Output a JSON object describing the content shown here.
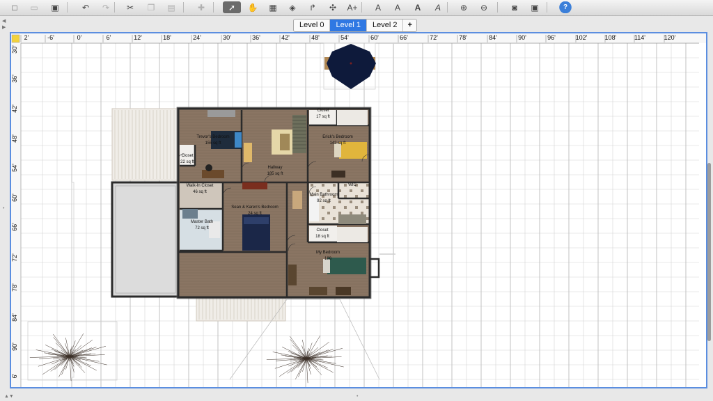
{
  "toolbar": {
    "buttons": [
      {
        "name": "new-home-icon",
        "glyph": "□"
      },
      {
        "name": "open-icon",
        "glyph": "▭"
      },
      {
        "name": "save-icon",
        "glyph": "▣"
      },
      {
        "name": "undo-icon",
        "glyph": "↶"
      },
      {
        "name": "redo-icon",
        "glyph": "↷"
      },
      {
        "name": "cut-icon",
        "glyph": "✂"
      },
      {
        "name": "copy-icon",
        "glyph": "❐"
      },
      {
        "name": "paste-icon",
        "glyph": "▤"
      },
      {
        "name": "add-furniture-icon",
        "glyph": "✚"
      },
      {
        "name": "select-mode-icon",
        "glyph": "➚"
      },
      {
        "name": "pan-mode-icon",
        "glyph": "✋"
      },
      {
        "name": "create-walls-icon",
        "glyph": "▦"
      },
      {
        "name": "create-rooms-icon",
        "glyph": "◈"
      },
      {
        "name": "create-polylines-icon",
        "glyph": "↱"
      },
      {
        "name": "create-dimensions-icon",
        "glyph": "✣"
      },
      {
        "name": "add-text-icon",
        "glyph": "A+"
      },
      {
        "name": "increase-text-size-icon",
        "glyph": "A"
      },
      {
        "name": "decrease-text-size-icon",
        "glyph": "A"
      },
      {
        "name": "bold-text-icon",
        "glyph": "A"
      },
      {
        "name": "italic-text-icon",
        "glyph": "A"
      },
      {
        "name": "zoom-in-icon",
        "glyph": "⊕"
      },
      {
        "name": "zoom-out-icon",
        "glyph": "⊖"
      },
      {
        "name": "create-photo-icon",
        "glyph": "◙"
      },
      {
        "name": "create-video-icon",
        "glyph": "▣"
      },
      {
        "name": "help-icon",
        "glyph": "?"
      }
    ]
  },
  "levels": {
    "tabs": [
      "Level 0",
      "Level 1",
      "Level 2"
    ],
    "active": "Level 1",
    "add_label": "+"
  },
  "ruler": {
    "top_labels": [
      "2'",
      "-6'",
      "0'",
      "6'",
      "12'",
      "18'",
      "24'",
      "30'",
      "36'",
      "42'",
      "48'",
      "54'",
      "60'",
      "66'",
      "72'",
      "78'",
      "84'",
      "90'",
      "96'",
      "102'",
      "108'",
      "114'",
      "120'"
    ],
    "left_labels": [
      "30'",
      "36'",
      "42'",
      "48'",
      "54'",
      "60'",
      "66'",
      "72'",
      "78'",
      "84'",
      "90'",
      "6'"
    ]
  },
  "rooms": [
    {
      "name": "Trevor's Bedroom",
      "area": "155 sq ft",
      "label": "Trevor's Bedroom"
    },
    {
      "name": "Hallway",
      "area": "185 sq ft"
    },
    {
      "name": "Closet",
      "area": "17 sq ft"
    },
    {
      "name": "Erick's Bedroom",
      "area": "142 sq ft"
    },
    {
      "name": "Closet",
      "area": "22 sq ft"
    },
    {
      "name": "Walk-In Closet",
      "area": "46 sq ft"
    },
    {
      "name": "Sean & Karen's Bedroom",
      "area": "24 sq ft"
    },
    {
      "name": "Main Bathroom",
      "area": "92 sq ft"
    },
    {
      "name": "Master Bath",
      "area": "72 sq ft"
    },
    {
      "name": "Closet",
      "area": "18 sq ft"
    },
    {
      "name": "My Bedroom",
      "area": "188"
    },
    {
      "name": "WIC",
      "area": ""
    }
  ],
  "colors": {
    "accent": "#2f78e3",
    "plan_border": "#5b8ee0",
    "grid": "#d4d4d4",
    "wall": "#2b2b2b",
    "wood_floor": "#8a7563",
    "tile_floor": "#e9e2d8",
    "gray_room": "#d8d8d8",
    "porch": "#f0ede8",
    "umbrella": "#0e1a3b"
  }
}
